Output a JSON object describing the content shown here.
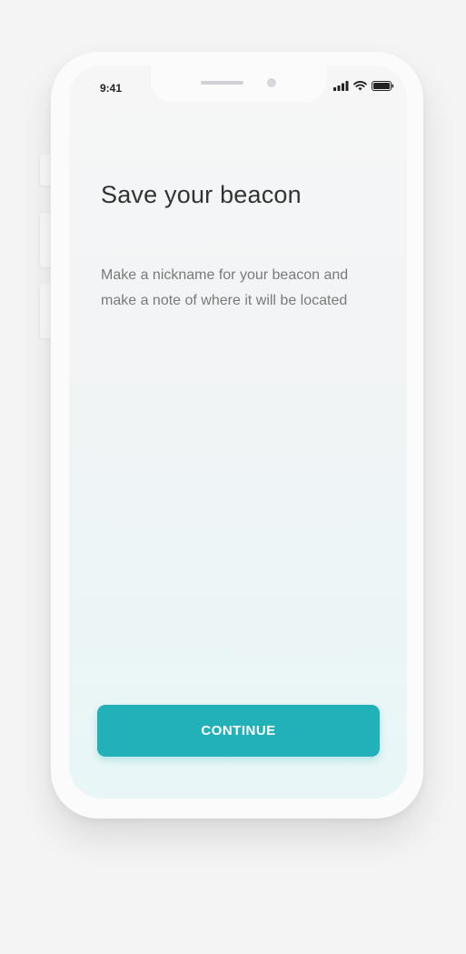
{
  "status_bar": {
    "time": "9:41",
    "icons": [
      "signal-icon",
      "wifi-icon",
      "battery-icon"
    ]
  },
  "screen": {
    "title": "Save your beacon",
    "description": "Make a nickname for your beacon and make a note of where it will be located",
    "continue_label": "CONTINUE"
  },
  "colors": {
    "accent": "#23b1b9",
    "title_text": "#333333",
    "body_text": "#7a7a7a",
    "background_top": "#f6f6f6",
    "background_bottom": "#e8f6f7"
  }
}
